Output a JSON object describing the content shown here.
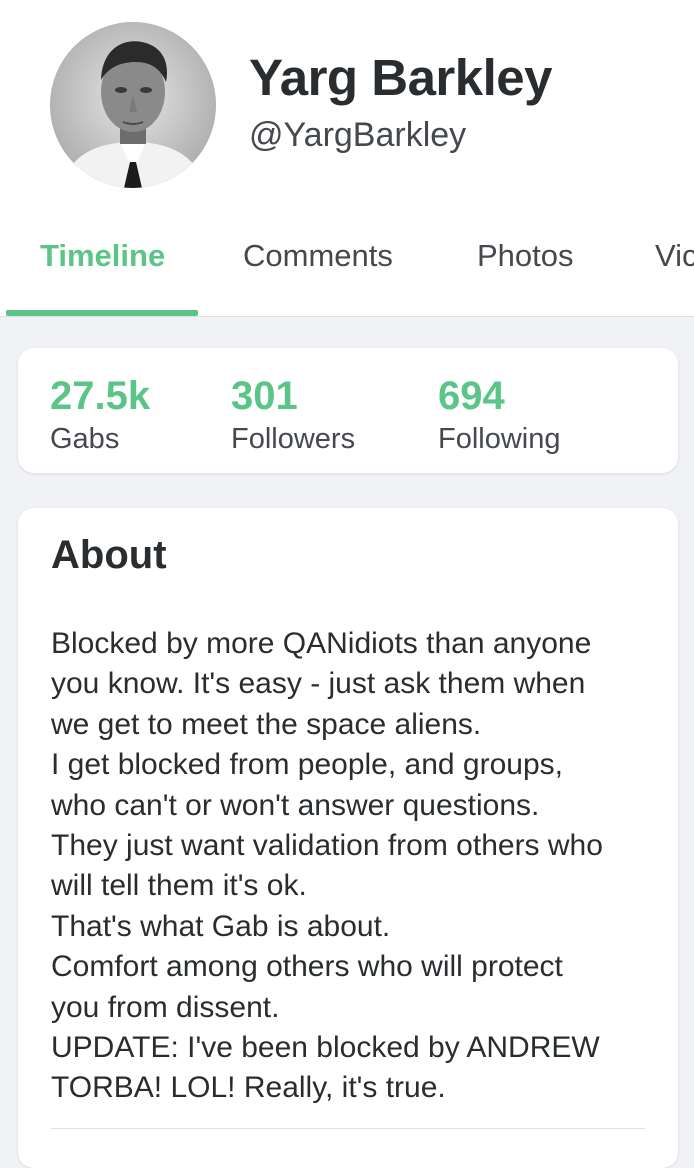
{
  "profile": {
    "display_name": "Yarg Barkley",
    "username": "@YargBarkley"
  },
  "tabs": [
    {
      "label": "Timeline",
      "active": true
    },
    {
      "label": "Comments",
      "active": false
    },
    {
      "label": "Photos",
      "active": false
    },
    {
      "label": "Vic",
      "active": false
    }
  ],
  "stats": [
    {
      "value": "27.5k",
      "label": "Gabs"
    },
    {
      "value": "301",
      "label": "Followers"
    },
    {
      "value": "694",
      "label": "Following"
    }
  ],
  "about": {
    "title": "About",
    "lines": [
      "Blocked by more QANidiots than anyone",
      "you know. It's easy - just ask them when",
      "we get to meet the space aliens.",
      "I get blocked from people, and groups,",
      "who can't or won't answer questions.",
      "They just want validation from others who",
      "will tell them it's ok.",
      "That's what Gab is about.",
      "Comfort among others who will protect",
      "you from dissent.",
      "UPDATE: I've been blocked by ANDREW",
      "TORBA! LOL! Really, it's true."
    ]
  },
  "colors": {
    "accent": "#5ac586",
    "background": "#f0f2f5",
    "card": "#ffffff",
    "text": "#2a2d30"
  }
}
